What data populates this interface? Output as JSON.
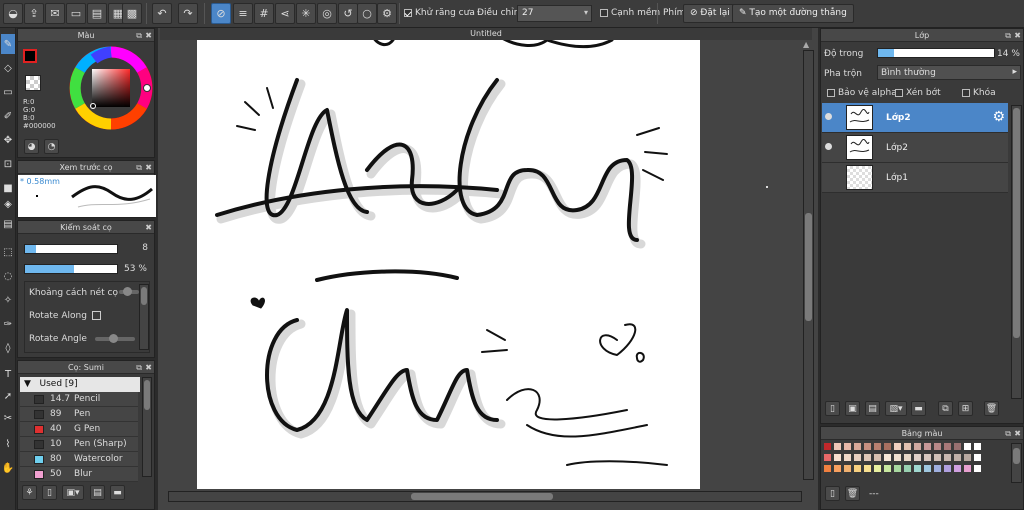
{
  "toolbar": {
    "antialias_label": "Khử răng cưa",
    "adjust_label": "Điều chỉnh",
    "adjust_value": "27",
    "smooth_label": "Cạnh mềm",
    "key_label": "Phím",
    "reset_label": "Đặt lại",
    "straight_label": "Tạo một đường thẳng"
  },
  "color_panel": {
    "title": "Màu",
    "r": "R:0",
    "g": "G:0",
    "b": "B:0",
    "hex": "#000000",
    "primary_color": "#000000",
    "secondary_color": "#ffffff"
  },
  "preview_panel": {
    "title": "Xem trước cọ",
    "size_text": "* 0.58mm"
  },
  "brush_control": {
    "title": "Kiểm soát cọ",
    "size_value": "8",
    "opacity_value": "53 %",
    "size_fraction": 0.12,
    "opacity_fraction": 0.53,
    "spacing_label": "Khoảng cách nét cọ",
    "rotate_along_label": "Rotate Along",
    "rotate_angle_label": "Rotate Angle"
  },
  "brush_list": {
    "title": "Cọ: Sumi",
    "group_label": "Used [9]",
    "items": [
      {
        "size": "14.7",
        "name": "Pencil",
        "color": "#333333"
      },
      {
        "size": "89",
        "name": "Pen",
        "color": "#333333"
      },
      {
        "size": "40",
        "name": "G Pen",
        "color": "#e03030"
      },
      {
        "size": "10",
        "name": "Pen (Sharp)",
        "color": "#333333"
      },
      {
        "size": "80",
        "name": "Watercolor",
        "color": "#6fd0ef"
      },
      {
        "size": "50",
        "name": "Blur",
        "color": "#f0a0d0"
      }
    ]
  },
  "canvas": {
    "tab_title": "Untitled"
  },
  "layers_panel": {
    "title": "Lớp",
    "opacity_label": "Độ trong",
    "opacity_value": "14 %",
    "opacity_fraction": 0.14,
    "blend_label": "Pha trộn",
    "blend_value": "Bình thường",
    "protect_alpha_label": "Bảo vệ alpha",
    "clip_label": "Xén bớt",
    "lock_label": "Khóa",
    "layers": [
      {
        "name": "Lớp2",
        "selected": true,
        "visible": true
      },
      {
        "name": "Lớp2",
        "selected": false,
        "visible": true
      },
      {
        "name": "Lớp1",
        "selected": false,
        "visible": false
      }
    ]
  },
  "palette_panel": {
    "title": "Bảng màu",
    "footer_text": "---"
  }
}
